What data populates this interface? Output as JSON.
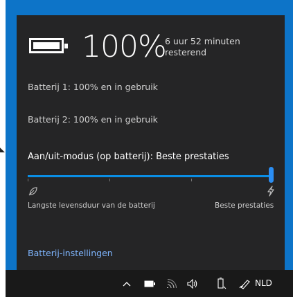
{
  "battery": {
    "percent": "100%",
    "time_line1": "6 uur  52 minuten",
    "time_line2": "resterend",
    "battery1": "Batterij 1: 100% en in gebruik",
    "battery2": "Batterij 2: 100% en in gebruik"
  },
  "power_mode": {
    "label": "Aan/uit-modus (op batterij): Beste prestaties",
    "slider_value_percent": 100,
    "left_label": "Langste levensduur van de batterij",
    "right_label": "Beste prestaties"
  },
  "settings_link": "Batterij-instellingen",
  "taskbar": {
    "language": "NLD",
    "icons": [
      "chevron-up-icon",
      "battery-icon",
      "wifi-icon",
      "speaker-icon",
      "device-icon",
      "pen-icon"
    ]
  },
  "colors": {
    "desktop_blue": "#0d74c8",
    "flyout_bg": "#252526",
    "accent": "#0a8ee4",
    "link": "#7fb6ff",
    "taskbar_bg": "#191919"
  }
}
